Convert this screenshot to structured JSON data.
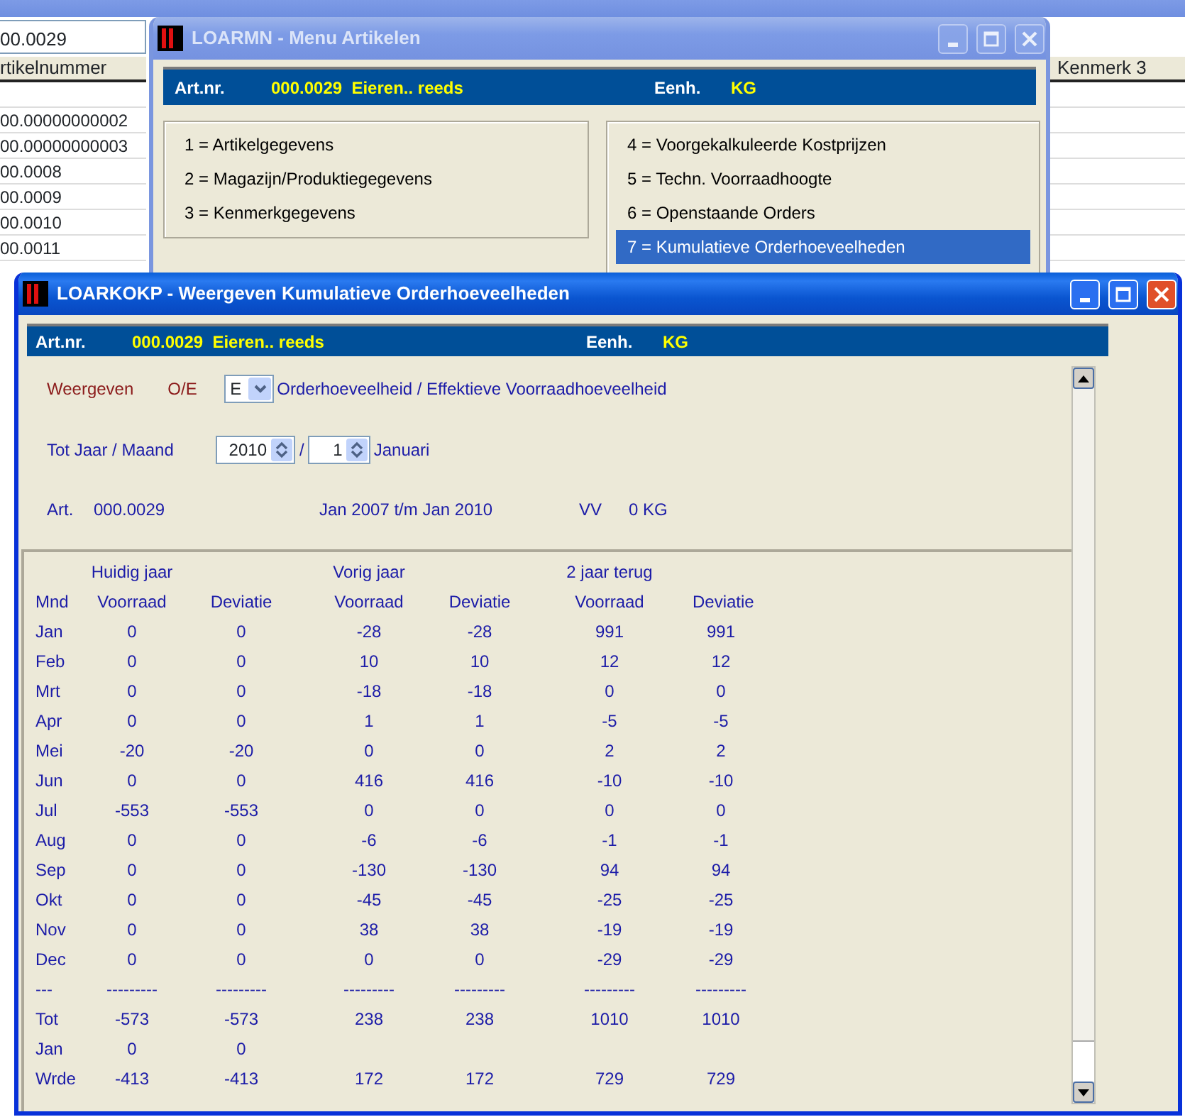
{
  "background_window": {
    "search_value": "00.0029",
    "columns": [
      "rtikelnummer",
      "Kenmerk 3"
    ],
    "rows": [
      "",
      "00.00000000002",
      "00.00000000003",
      "00.0008",
      "00.0009",
      "00.0010",
      "00.0011"
    ]
  },
  "menu_window": {
    "title": "LOARMN - Menu Artikelen",
    "active": false,
    "header": {
      "art_label": "Art.nr.",
      "art_value": "000.0029  Eieren.. reeds",
      "unit_label": "Eenh.",
      "unit_value": "KG"
    },
    "left_options": [
      {
        "label": "1 = Artikelgegevens",
        "selected": false
      },
      {
        "label": "2 = Magazijn/Produktiegegevens",
        "selected": false
      },
      {
        "label": "3 = Kenmerkgegevens",
        "selected": false
      }
    ],
    "right_options": [
      {
        "label": "4 = Voorgekalkuleerde Kostprijzen",
        "selected": false
      },
      {
        "label": "5 = Techn. Voorraadhoogte",
        "selected": false
      },
      {
        "label": "6 = Openstaande Orders",
        "selected": false
      },
      {
        "label": "7 = Kumulatieve Orderhoeveelheden",
        "selected": true
      }
    ]
  },
  "main_window": {
    "title": "LOARKOKP - Weergeven Kumulatieve Orderhoeveelheden",
    "active": true,
    "header": {
      "art_label": "Art.nr.",
      "art_value": "000.0029  Eieren.. reeds",
      "unit_label": "Eenh.",
      "unit_value": "KG"
    },
    "display": {
      "label": "Weergeven",
      "code_label": "O/E",
      "value": "E",
      "description": "Orderhoeveelheid / Effektieve Voorraadhoeveelheid"
    },
    "period": {
      "label": "Tot Jaar / Maand",
      "year": "2010",
      "separator": "/",
      "month": "1",
      "month_name": "Januari"
    },
    "info": {
      "art_label": "Art.",
      "art_value": "000.0029",
      "range": "Jan 2007 t/m Jan 2010",
      "vv_label": "VV",
      "vv_value": "0 KG"
    },
    "groups": [
      "Huidig jaar",
      "Vorig jaar",
      "2 jaar terug"
    ],
    "columns": [
      "Mnd",
      "Voorraad",
      "Deviatie",
      "Voorraad",
      "Deviatie",
      "Voorraad",
      "Deviatie"
    ],
    "rows": [
      [
        "Jan",
        "0",
        "0",
        "-28",
        "-28",
        "991",
        "991"
      ],
      [
        "Feb",
        "0",
        "0",
        "10",
        "10",
        "12",
        "12"
      ],
      [
        "Mrt",
        "0",
        "0",
        "-18",
        "-18",
        "0",
        "0"
      ],
      [
        "Apr",
        "0",
        "0",
        "1",
        "1",
        "-5",
        "-5"
      ],
      [
        "Mei",
        "-20",
        "-20",
        "0",
        "0",
        "2",
        "2"
      ],
      [
        "Jun",
        "0",
        "0",
        "416",
        "416",
        "-10",
        "-10"
      ],
      [
        "Jul",
        "-553",
        "-553",
        "0",
        "0",
        "0",
        "0"
      ],
      [
        "Aug",
        "0",
        "0",
        "-6",
        "-6",
        "-1",
        "-1"
      ],
      [
        "Sep",
        "0",
        "0",
        "-130",
        "-130",
        "94",
        "94"
      ],
      [
        "Okt",
        "0",
        "0",
        "-45",
        "-45",
        "-25",
        "-25"
      ],
      [
        "Nov",
        "0",
        "0",
        "38",
        "38",
        "-19",
        "-19"
      ],
      [
        "Dec",
        "0",
        "0",
        "0",
        "0",
        "-29",
        "-29"
      ],
      [
        "---",
        "---------",
        "---------",
        "---------",
        "---------",
        "---------",
        "---------"
      ],
      [
        "Tot",
        "-573",
        "-573",
        "238",
        "238",
        "1010",
        "1010"
      ],
      [
        "Jan",
        "0",
        "0",
        "",
        "",
        "",
        ""
      ],
      [
        "Wrde",
        "-413",
        "-413",
        "172",
        "172",
        "729",
        "729"
      ]
    ]
  }
}
